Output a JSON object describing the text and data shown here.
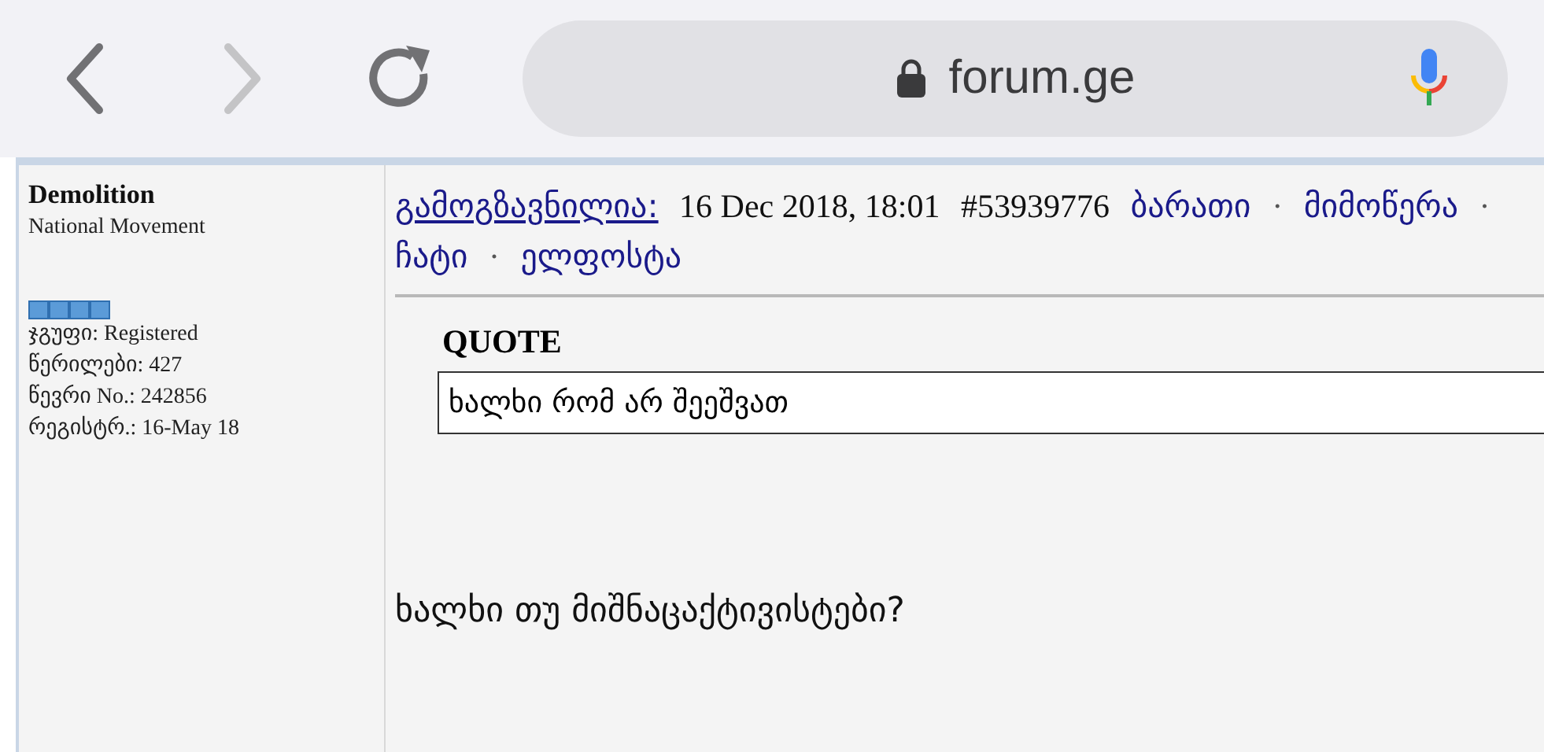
{
  "toolbar": {
    "nav": [
      {
        "kind": "back",
        "disabled": false
      },
      {
        "kind": "forward",
        "disabled": true
      },
      {
        "kind": "reload",
        "disabled": false
      }
    ],
    "address": "forum.ge"
  },
  "author": {
    "name": "Demolition",
    "title": "National Movement",
    "stats": [
      {
        "label": "ჯგუფი:",
        "value": "Registered"
      },
      {
        "label": "წერილები:",
        "value": "427"
      },
      {
        "label": "წევრი No.:",
        "value": "242856"
      },
      {
        "label": "რეგისტრ.:",
        "value": "16-May 18"
      }
    ]
  },
  "post": {
    "header": [
      {
        "kind": "link",
        "text": "გამოგზავნილია:",
        "underlined": true
      },
      {
        "kind": "text",
        "text": "16 Dec 2018, 18:01"
      },
      {
        "kind": "text",
        "text": "#53939776"
      },
      {
        "kind": "link",
        "text": "ბარათი",
        "underlined": false
      },
      {
        "kind": "separator",
        "text": "·"
      },
      {
        "kind": "link",
        "text": "მიმოწერა",
        "underlined": false
      },
      {
        "kind": "separator",
        "text": "·"
      },
      {
        "kind": "link",
        "text": "ჩატი",
        "underlined": false
      },
      {
        "kind": "separator",
        "text": "·"
      },
      {
        "kind": "link",
        "text": "ელფოსტა",
        "underlined": false
      }
    ],
    "quote": {
      "label": "QUOTE",
      "text": "ხალხი რომ არ შეეშვათ"
    },
    "body": "ხალხი თუ მიშნაცაქტივისტები?"
  }
}
